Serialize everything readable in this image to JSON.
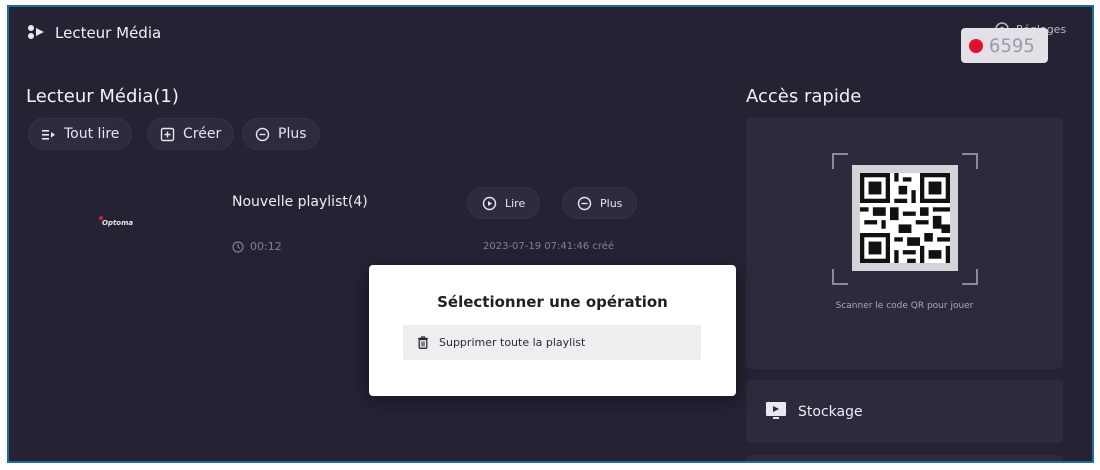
{
  "app": {
    "title": "Lecteur Média"
  },
  "settings": {
    "label": "Réglages"
  },
  "recording": {
    "count": "6595",
    "color": "#e0132f"
  },
  "library": {
    "title": "Lecteur Média(1)",
    "actions": [
      {
        "label": "Tout lire",
        "icon": "play-all-icon"
      },
      {
        "label": "Créer",
        "icon": "create-icon"
      },
      {
        "label": "Plus",
        "icon": "more-icon"
      }
    ]
  },
  "playlist": {
    "brand": "Optoma",
    "name": "Nouvelle playlist(4)",
    "duration": "00:12",
    "created": "2023-07-19 07:41:46 créé",
    "play_label": "Lire",
    "more_label": "Plus"
  },
  "quick_access": {
    "title": "Accès rapide",
    "qr_caption": "Scanner le code QR pour jouer",
    "storage_label": "Stockage"
  },
  "modal": {
    "title": "Sélectionner une opération",
    "option_label": "Supprimer toute la playlist"
  },
  "colors": {
    "background": "#242233",
    "card": "#2c2a3c",
    "frame": "#1d6f9a",
    "modal": "#ffffff"
  }
}
